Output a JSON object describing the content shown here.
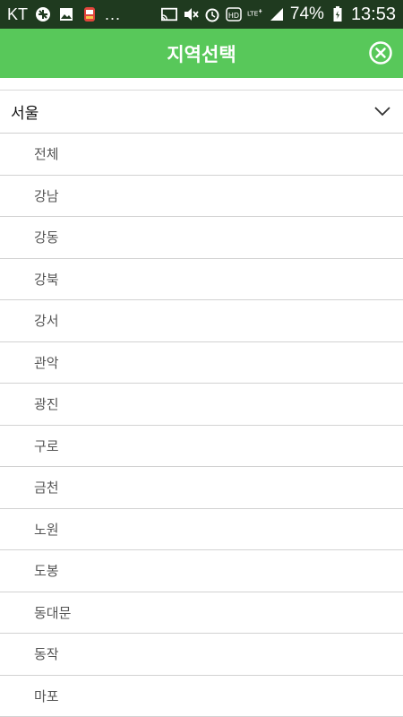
{
  "status_bar": {
    "carrier": "KT",
    "overflow": "...",
    "battery_percent": "74%",
    "time": "13:53",
    "icons": [
      "no-fly-icon",
      "image-icon",
      "app-icon",
      "cast-icon",
      "mute-icon",
      "alarm-icon",
      "hd-icon",
      "lte-icon",
      "signal-icon",
      "battery-icon"
    ]
  },
  "header": {
    "title": "지역선택",
    "close_icon": "close-circle-icon",
    "background": "#58c85a"
  },
  "region": {
    "label": "서울",
    "expand_icon": "chevron-down-icon"
  },
  "districts": [
    {
      "label": "전체"
    },
    {
      "label": "강남"
    },
    {
      "label": "강동"
    },
    {
      "label": "강북"
    },
    {
      "label": "강서"
    },
    {
      "label": "관악"
    },
    {
      "label": "광진"
    },
    {
      "label": "구로"
    },
    {
      "label": "금천"
    },
    {
      "label": "노원"
    },
    {
      "label": "도봉"
    },
    {
      "label": "동대문"
    },
    {
      "label": "동작"
    },
    {
      "label": "마포"
    }
  ]
}
